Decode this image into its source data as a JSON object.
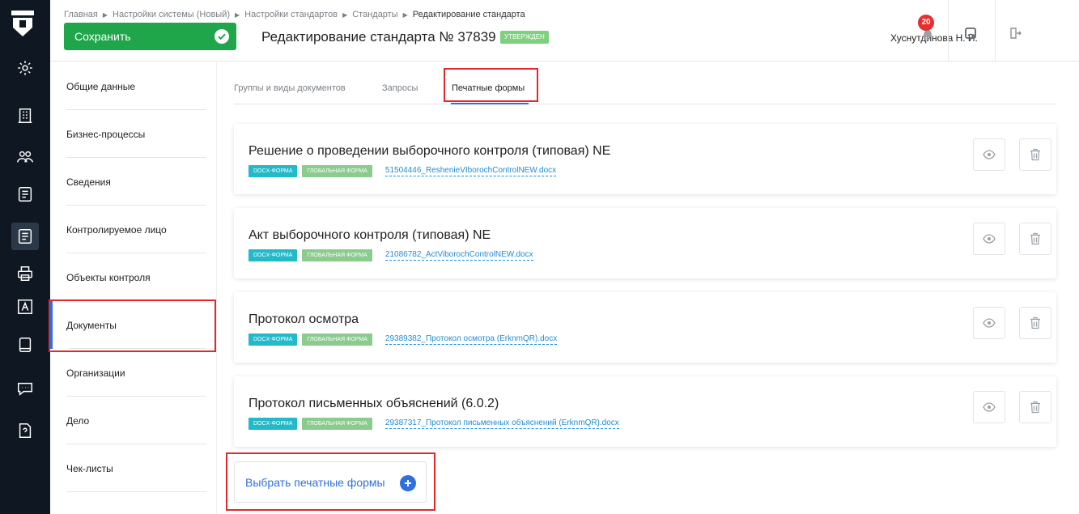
{
  "breadcrumb": {
    "items": [
      "Главная",
      "Настройки системы (Новый)",
      "Настройки стандартов",
      "Стандарты",
      "Редактирование стандарта"
    ]
  },
  "header": {
    "save_label": "Сохранить",
    "title": "Редактирование стандарта № 37839",
    "status": "УТВЕРЖДЕН",
    "user": "Хуснутдинова Н. И.",
    "notifications_count": "20"
  },
  "menu": {
    "items": [
      {
        "label": "Общие данные"
      },
      {
        "label": "Бизнес-процессы"
      },
      {
        "label": "Сведения"
      },
      {
        "label": "Контролируемое лицо"
      },
      {
        "label": "Объекты контроля"
      },
      {
        "label": "Документы"
      },
      {
        "label": "Организации"
      },
      {
        "label": "Дело"
      },
      {
        "label": "Чек-листы"
      }
    ],
    "active": "Документы"
  },
  "tabs": [
    {
      "label": "Группы и виды документов"
    },
    {
      "label": "Запросы"
    },
    {
      "label": "Печатные формы"
    }
  ],
  "active_tab": "Печатные формы",
  "tags": {
    "docx": "DOCX-ФОРМА",
    "global": "ГЛОБАЛЬНАЯ ФОРМА"
  },
  "forms": [
    {
      "title": "Решение о проведении выборочного контроля (типовая) NE",
      "file": "51504446_ResheniеVIborochControlNEW.docx"
    },
    {
      "title": "Акт выборочного контроля (типовая) NE",
      "file": "21086782_ActViborochControlNEW.docx"
    },
    {
      "title": "Протокол осмотра",
      "file": "29389382_Протокол осмотра (ErknmQR).docx"
    },
    {
      "title": "Протокол письменных объяснений (6.0.2)",
      "file": "29387317_Протокол письменных объяснений (ErknmQR).docx"
    }
  ],
  "select_label": "Выбрать печатные формы",
  "colors": {
    "accent": "#2f6fe0",
    "save": "#1fa64a",
    "rail": "#0f1822",
    "highlight": "#e0282e",
    "docx_tag": "#22b9c9",
    "global_tag": "#8bcb8e"
  }
}
